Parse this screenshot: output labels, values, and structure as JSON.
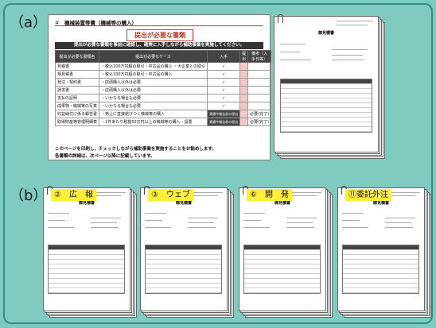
{
  "labels": {
    "a": "（a）",
    "b": "（b）"
  },
  "checklist": {
    "header": "①　機械装置等費（機械等の購入）",
    "title": "提出が必要な書類",
    "band": "提出が必要な書類を事前に確認し、確実に入手しながら補助事業を実施してください。",
    "columns": [
      "提出が必要な書類名",
      "提出が必要なケース",
      "入手",
      "提出",
      "備考（入手日等）"
    ],
    "check_header": "チェック欄",
    "sub_headers": [
      "事前の手続",
      "実績報告書"
    ],
    "rows": [
      {
        "name": "見積書",
        "case": "・税込100万円超の取引・中古品の購入\n・大企業との取引",
        "mark": "✓"
      },
      {
        "name": "相見積書",
        "case": "・税込100万円超の取引・中古品の購入",
        "mark": "✓"
      },
      {
        "name": "発注・契約書",
        "case": "・店頭購入以外は必要",
        "mark": "✓"
      },
      {
        "name": "請求書",
        "case": "・店頭購入以外は必要",
        "mark": "✓"
      },
      {
        "name": "支払の証明",
        "case": "・いかなる場合も必要",
        "mark": "✓"
      },
      {
        "name": "成果物・機械等の写真",
        "case": "・いかなる場合も必要",
        "mark": "✓"
      },
      {
        "name": "収益納付に係る報告書",
        "case": "・売上に直接結びつく機械等の購入",
        "mark": "",
        "dark": "実績中報告前の提出",
        "tail": "必要(完了)"
      },
      {
        "name": "取得財産等管理明細表",
        "case": "・1件あたり税抜50万円以上の機械等の購入・設置",
        "mark": "",
        "dark": "実績中報告前の提出",
        "tail": "必要(完了)"
      }
    ],
    "note1": "このページを印刷し、チェックしながら補助事業を実施することをお勧めします。",
    "note2": "各書類の詳細は、次ページ以降に記載しています。"
  },
  "estimate": {
    "title": "御見積書",
    "company": "株式会社 日本ITサービス"
  },
  "categories": [
    {
      "label": "②　広　報"
    },
    {
      "label": "③　ウェブ"
    },
    {
      "label": "⑥　開　発"
    },
    {
      "label": "⑪委託外注"
    }
  ]
}
